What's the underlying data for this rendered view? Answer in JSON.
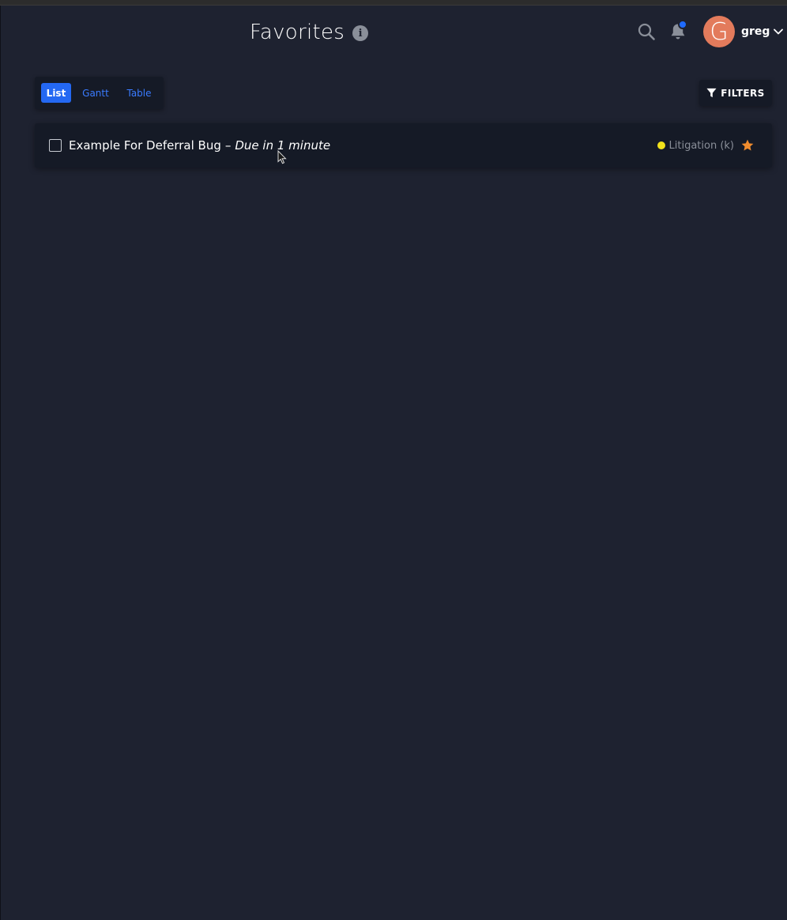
{
  "header": {
    "title": "Favorites",
    "info_icon": "info-circle-icon",
    "search_icon": "search-icon",
    "notifications_icon": "bell-icon",
    "notification_badge_color": "#1f6bff"
  },
  "user": {
    "avatar_initial": "G",
    "avatar_color": "#e37b5c",
    "name": "greg",
    "menu_icon": "chevron-down-icon"
  },
  "views": {
    "active": "List",
    "tabs": [
      {
        "label": "List"
      },
      {
        "label": "Gantt"
      },
      {
        "label": "Table"
      }
    ],
    "active_color": "#2468f2",
    "link_color": "#3a7bff"
  },
  "filters": {
    "label": "FILTERS",
    "icon": "filter-icon"
  },
  "tasks": [
    {
      "title": "Example For Deferral Bug",
      "separator": "–",
      "due": "Due in 1 minute",
      "project": "Litigation (k)",
      "project_color": "#f2e21b",
      "favorite": true,
      "favorite_color": "#f08c2e",
      "checked": false
    }
  ],
  "colors": {
    "background": "#1e2230",
    "card": "#151a26"
  }
}
